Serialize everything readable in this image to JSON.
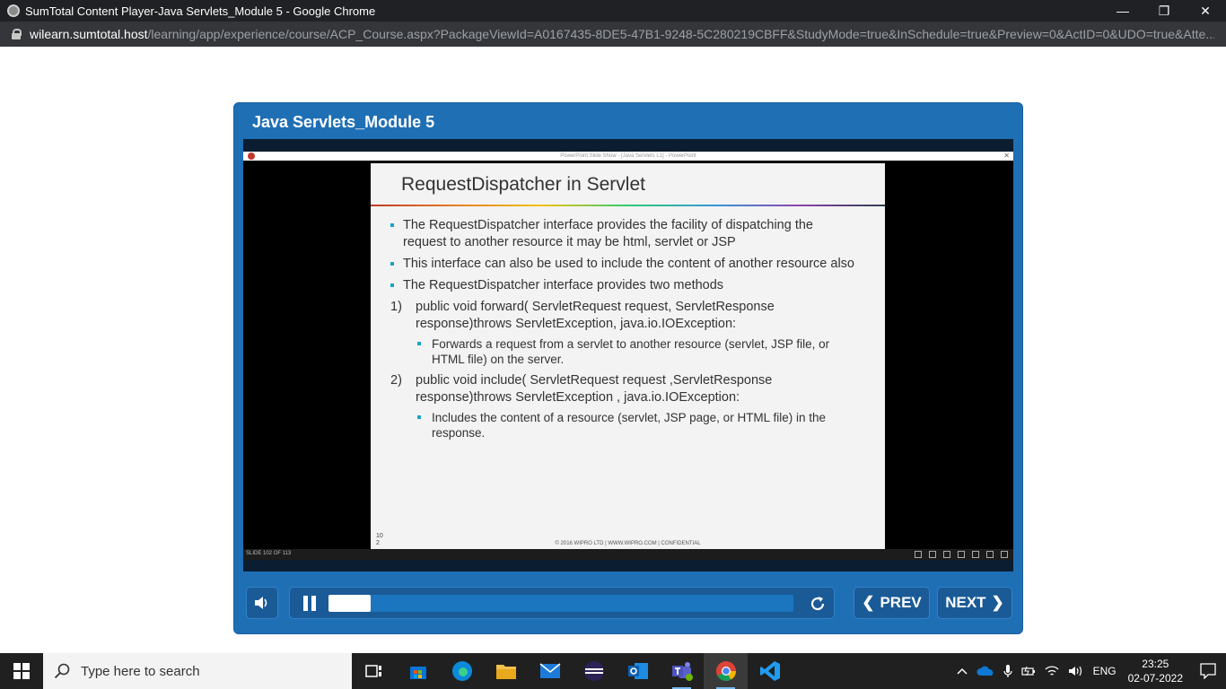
{
  "browser": {
    "window_title": "SumTotal Content Player-Java Servlets_Module 5 - Google Chrome",
    "url_host": "wilearn.sumtotal.host",
    "url_path": "/learning/app/experience/course/ACP_Course.aspx?PackageViewId=A0167435-8DE5-47B1-9248-5C280219CBFF&StudyMode=true&InSchedule=true&Preview=0&ActID=0&UDO=true&Atte..."
  },
  "player": {
    "title": "Java Servlets_Module 5",
    "pp_window_title": "PowerPoint Slide Show - [Java Servlets L1] - PowerPoint",
    "slide_counter": "SLIDE 102 OF 113",
    "progress_fraction": 0.09,
    "prev_label": "PREV",
    "next_label": "NEXT"
  },
  "slide": {
    "title": "RequestDispatcher in Servlet",
    "bullet1": "The RequestDispatcher interface provides the facility of dispatching the request to another resource it may be html, servlet or JSP",
    "bullet2": "This interface can also be used to include the content of another resource also",
    "bullet3": "The RequestDispatcher interface provides two methods",
    "m1_num": "1)",
    "m1_text": "public void forward( ServletRequest request, ServletResponse response)throws ServletException, java.io.IOException:",
    "m1_sub": "Forwards a request from a servlet to another resource (servlet, JSP file, or HTML file) on the server.",
    "m2_num": "2)",
    "m2_text": "public void include( ServletRequest request ,ServletResponse response)throws ServletException , java.io.IOException:",
    "m2_sub": "Includes the content of a resource (servlet, JSP page, or HTML file) in the response.",
    "page_number": "10 2",
    "footer": "© 2016 WIPRO LTD | WWW.WIPRO.COM | CONFIDENTIAL"
  },
  "taskbar": {
    "search_placeholder": "Type here to search",
    "language": "ENG",
    "time": "23:25",
    "date": "02-07-2022"
  }
}
